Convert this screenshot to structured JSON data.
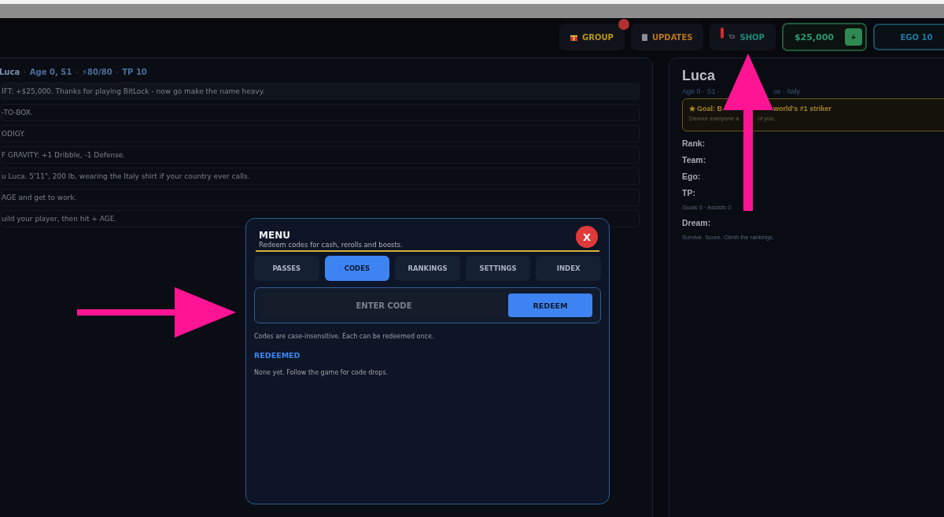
{
  "top_bar": {
    "buttons": [
      {
        "kind": "group",
        "label": "GROUP",
        "alert": true
      },
      {
        "kind": "updates",
        "label": "UPDATES",
        "alert": false
      },
      {
        "kind": "shop",
        "label": "SHOP",
        "alert": true
      }
    ],
    "cash": "$25,000",
    "cash_add": "+",
    "ego": "EGO 10"
  },
  "log_panel": {
    "header": [
      "Luca",
      "Age 0, S1",
      "⚡80/80",
      "TP 10"
    ],
    "separator": "·",
    "entries": [
      "IFT: +$25,000. Thanks for playing BitLock - now go make the name heavy.",
      "-TO-BOX.",
      "ODIGY.",
      "F GRAVITY: +1 Dribble, -1 Defense.",
      "u Luca. 5'11\", 200 lb, wearing the Italy shirt if your country ever calls.",
      "AGE and get to work.",
      "uild your player, then hit + AGE."
    ]
  },
  "profile": {
    "name": "Luca",
    "meta": [
      "Age 0 · S1 ·",
      "ox · Italy"
    ],
    "goal": {
      "title": [
        "Goal: B",
        "world's #1 striker"
      ],
      "subtitle": [
        "Devour everyone a",
        "of you."
      ]
    },
    "fields": [
      {
        "label": "Rank:"
      },
      {
        "label": "Team:"
      },
      {
        "label": "Ego:"
      },
      {
        "label": "TP:",
        "note": "Goals 0 · Assists 0"
      },
      {
        "label": "Dream:",
        "note": "Survive. Score. Climb the rankings."
      }
    ]
  },
  "menu": {
    "title": "MENU",
    "subtitle": "Redeem codes for cash, rerolls and boosts.",
    "close": "X",
    "tabs": [
      {
        "label": "PASSES",
        "selected": false
      },
      {
        "label": "CODES",
        "selected": true
      },
      {
        "label": "RANKINGS",
        "selected": false
      },
      {
        "label": "SETTINGS",
        "selected": false
      },
      {
        "label": "INDEX",
        "selected": false
      }
    ],
    "code_field": {
      "placeholder": "ENTER CODE"
    },
    "redeem": "REDEEM",
    "hint": "Codes are case-insensitive. Each can be redeemed once.",
    "redeemed_heading": "REDEEMED",
    "redeemed_text": "None yet. Follow the game for code drops."
  }
}
